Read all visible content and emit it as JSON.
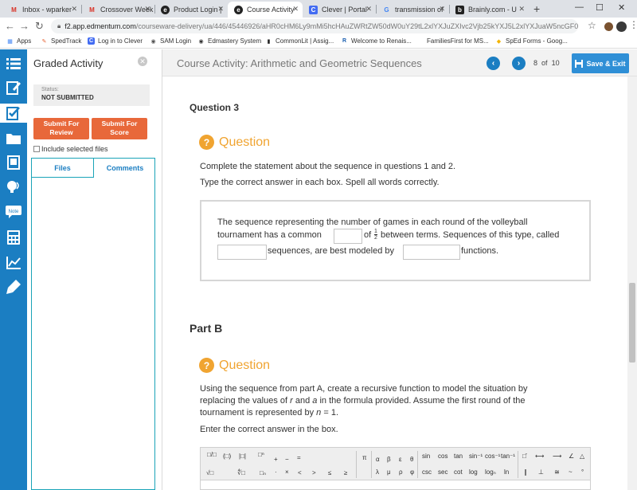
{
  "browser": {
    "tabs": [
      {
        "label": "Inbox - wparker",
        "fav": "M",
        "favColor": "#d93025",
        "favBg": "transparent",
        "active": false
      },
      {
        "label": "Crossover Week",
        "fav": "M",
        "favColor": "#d93025",
        "favBg": "transparent",
        "active": false
      },
      {
        "label": "Product Login |",
        "fav": "e",
        "favColor": "#fff",
        "favBg": "#222",
        "active": false
      },
      {
        "label": "Course Activity",
        "fav": "e",
        "favColor": "#fff",
        "favBg": "#222",
        "active": true
      },
      {
        "label": "Clever | Portal",
        "fav": "C",
        "favColor": "#fff",
        "favBg": "#436cf2",
        "active": false
      },
      {
        "label": "transmission of",
        "fav": "G",
        "favColor": "#4285f4",
        "favBg": "transparent",
        "active": false
      },
      {
        "label": "Brainly.com - U",
        "fav": "b",
        "favColor": "#fff",
        "favBg": "#222",
        "active": false
      }
    ],
    "new_tab": "+",
    "url_domain": "f2.app.edmentum.com",
    "url_path": "/courseware-delivery/ua/446/45446926/aHR0cHM6Ly9mMi5hcHAuZWRtZW50dW0uY29tL2xlYXJuZXIvc2Vjb25kYXJ5L2xlYXJuaW5ncGF0aC9p...",
    "bookmarks": [
      {
        "label": "Apps",
        "fav": "⋮⋮",
        "favColor": "#4285f4",
        "favBg": "transparent"
      },
      {
        "label": "SpedTrack",
        "fav": "✎",
        "favColor": "#e8683a",
        "favBg": "transparent"
      },
      {
        "label": "Log in to Clever",
        "fav": "C",
        "favColor": "#fff",
        "favBg": "#436cf2"
      },
      {
        "label": "SAM Login",
        "fav": "◉",
        "favColor": "#555",
        "favBg": "transparent"
      },
      {
        "label": "Edmastery System",
        "fav": "◉",
        "favColor": "#333",
        "favBg": "transparent"
      },
      {
        "label": "CommonLit | Assig...",
        "fav": "▮▮",
        "favColor": "#222",
        "favBg": "transparent"
      },
      {
        "label": "Welcome to Renais...",
        "fav": "R",
        "favColor": "#1b5fb0",
        "favBg": "transparent"
      },
      {
        "label": "FamiliesFirst for MS...",
        "fav": "",
        "favColor": "#fff",
        "favBg": "transparent"
      },
      {
        "label": "SpEd Forms - Goog...",
        "fav": "◆",
        "favColor": "#f4b400",
        "favBg": "transparent"
      }
    ]
  },
  "sidebar": {
    "title": "Graded Activity",
    "status_label": "Status:",
    "status_value": "NOT SUBMITTED",
    "submit_review": "Submit For Review",
    "submit_score": "Submit For Score",
    "include_files": "Include selected files",
    "tab_files": "Files",
    "tab_comments": "Comments"
  },
  "header": {
    "title": "Course Activity: Arithmetic and Geometric Sequences",
    "page_current": "8",
    "page_of": "of",
    "page_total": "10",
    "save_exit": "Save & Exit"
  },
  "content": {
    "question_number": "Question 3",
    "question_heading": "Question",
    "instruction1": "Complete the statement about the sequence in questions 1 and 2.",
    "instruction2": "Type the correct answer in each box. Spell all words correctly.",
    "stmt_line1": "The sequence representing the number of games in each round of the volleyball",
    "stmt_line2a": "tournament has a common",
    "stmt_line2b": "of",
    "frac_num": "1",
    "frac_den": "2",
    "stmt_line2c": "between terms. Sequences of this type, called",
    "stmt_line3a": "sequences, are best modeled by",
    "stmt_line3b": "functions.",
    "part_b": "Part B",
    "partb_heading": "Question",
    "partb_line1": "Using the sequence from part A, create a recursive function to model the situation by",
    "partb_line2_pre": "replacing the values of",
    "partb_r": "r",
    "partb_and": "and",
    "partb_a": "a",
    "partb_line2_post": "in the formula provided. Assume the first round of the",
    "partb_line3_pre": "tournament is represented by",
    "partb_n": "n",
    "partb_line3_post": "= 1.",
    "enter_answer": "Enter the correct answer in the box."
  },
  "math_toolbar": {
    "groups": [
      [
        "□/□",
        "(□)",
        "|□|",
        "□ⁿ",
        "+",
        "−",
        "=",
        "√□",
        "∜□",
        "□ₙ",
        "·",
        "×",
        "<",
        ">",
        "≤",
        "≥"
      ],
      [
        "π",
        "α",
        "β",
        "ε",
        "θ",
        "λ",
        "μ",
        "ρ",
        "φ"
      ],
      [
        "sin",
        "cos",
        "tan",
        "sin⁻¹",
        "cos⁻¹",
        "tan⁻¹",
        "csc",
        "sec",
        "cot",
        "log",
        "logₙ",
        "ln"
      ],
      [
        "□̄",
        "⟷",
        "⟶",
        "∠",
        "△",
        "∥",
        "⊥",
        "≅",
        "~",
        "°"
      ]
    ]
  }
}
